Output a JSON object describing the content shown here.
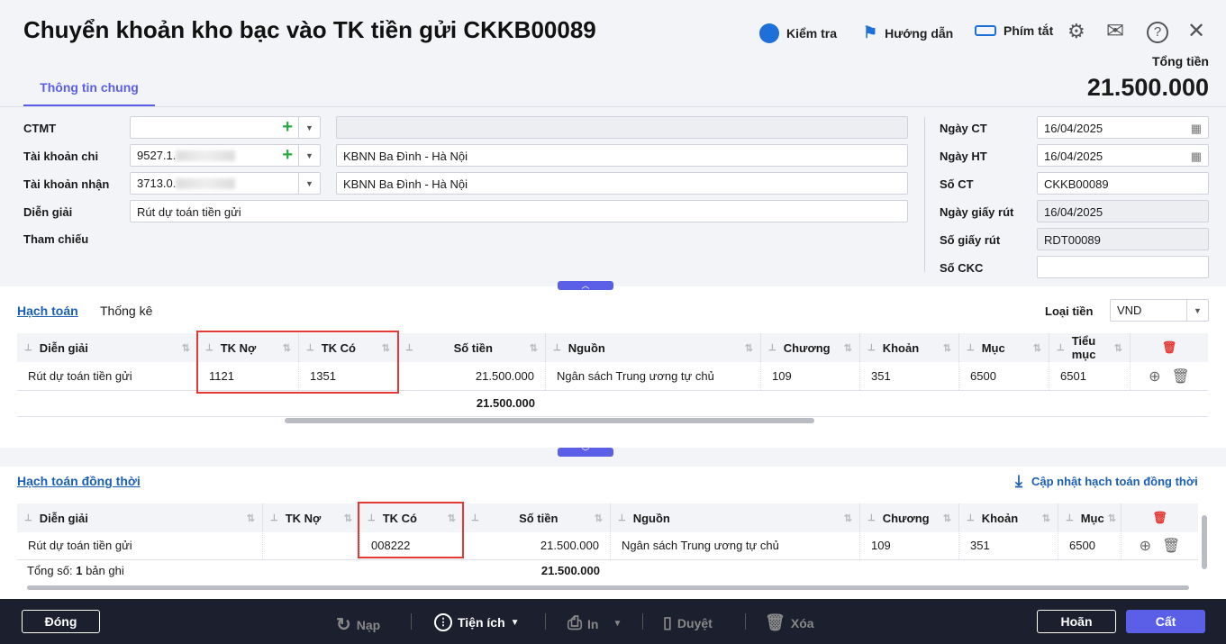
{
  "header": {
    "title": "Chuyển khoản kho bạc vào TK tiền gửi CKKB00089",
    "tools": [
      {
        "icon": "robot-check-icon",
        "label": "Kiểm tra"
      },
      {
        "icon": "signpost-icon",
        "label": "Hướng dẫn"
      },
      {
        "icon": "keyboard-icon",
        "label": "Phím tắt"
      }
    ],
    "total_label": "Tổng tiền",
    "total_value": "21.500.000",
    "tab": "Thông tin chung"
  },
  "form": {
    "ctmt": {
      "label": "CTMT",
      "value": "",
      "desc": ""
    },
    "tk_chi": {
      "label": "Tài khoản chi",
      "value": "9527.1.",
      "desc": "KBNN Ba Đình - Hà Nội"
    },
    "tk_nhan": {
      "label": "Tài khoản nhận",
      "value": "3713.0.",
      "desc": "KBNN Ba Đình - Hà Nội"
    },
    "dien_giai": {
      "label": "Diễn giải",
      "value": "Rút dự toán tiền gửi"
    },
    "tham_chieu": {
      "label": "Tham chiếu"
    },
    "right": [
      {
        "label": "Ngày CT",
        "value": "16/04/2025",
        "cal": true,
        "dis": false
      },
      {
        "label": "Ngày HT",
        "value": "16/04/2025",
        "cal": true,
        "dis": false
      },
      {
        "label": "Số CT",
        "value": "CKKB00089",
        "cal": false,
        "dis": false
      },
      {
        "label": "Ngày giấy rút",
        "value": "16/04/2025",
        "cal": false,
        "dis": true
      },
      {
        "label": "Số giấy rút",
        "value": "RDT00089",
        "cal": false,
        "dis": true
      },
      {
        "label": "Số CKC",
        "value": "",
        "cal": false,
        "dis": false
      }
    ]
  },
  "grid1": {
    "tabs": [
      "Hạch toán",
      "Thống kê"
    ],
    "currency_label": "Loại tiền",
    "currency": "VND",
    "columns": [
      "Diễn giải",
      "TK Nợ",
      "TK Có",
      "Số tiền",
      "Nguồn",
      "Chương",
      "Khoản",
      "Mục",
      "Tiểu mục"
    ],
    "rows": [
      [
        "Rút dự toán tiền gửi",
        "1121",
        "1351",
        "21.500.000",
        "Ngân sách Trung ương tự chủ",
        "109",
        "351",
        "6500",
        "6501"
      ]
    ],
    "total": "21.500.000"
  },
  "grid2": {
    "title": "Hạch toán đồng thời",
    "update_label": "Cập nhật hạch toán đồng thời",
    "columns": [
      "Diễn giải",
      "TK Nợ",
      "TK Có",
      "Số tiền",
      "Nguồn",
      "Chương",
      "Khoản",
      "Mục"
    ],
    "rows": [
      [
        "Rút dự toán tiền gửi",
        "",
        "008222",
        "21.500.000",
        "Ngân sách Trung ương tự chủ",
        "109",
        "351",
        "6500"
      ]
    ],
    "count_label": "Tổng số:",
    "count": "1",
    "count_suffix": "bản ghi",
    "total": "21.500.000"
  },
  "footer": {
    "close": "Đóng",
    "reload": "Nạp",
    "utilities": "Tiện ích",
    "print": "In",
    "approve": "Duyệt",
    "delete": "Xóa",
    "cancel": "Hoãn",
    "save": "Cất"
  },
  "colors": {
    "accent": "#5b5fe8",
    "footer": "#1c1f2e",
    "highlight": "#e53935"
  }
}
